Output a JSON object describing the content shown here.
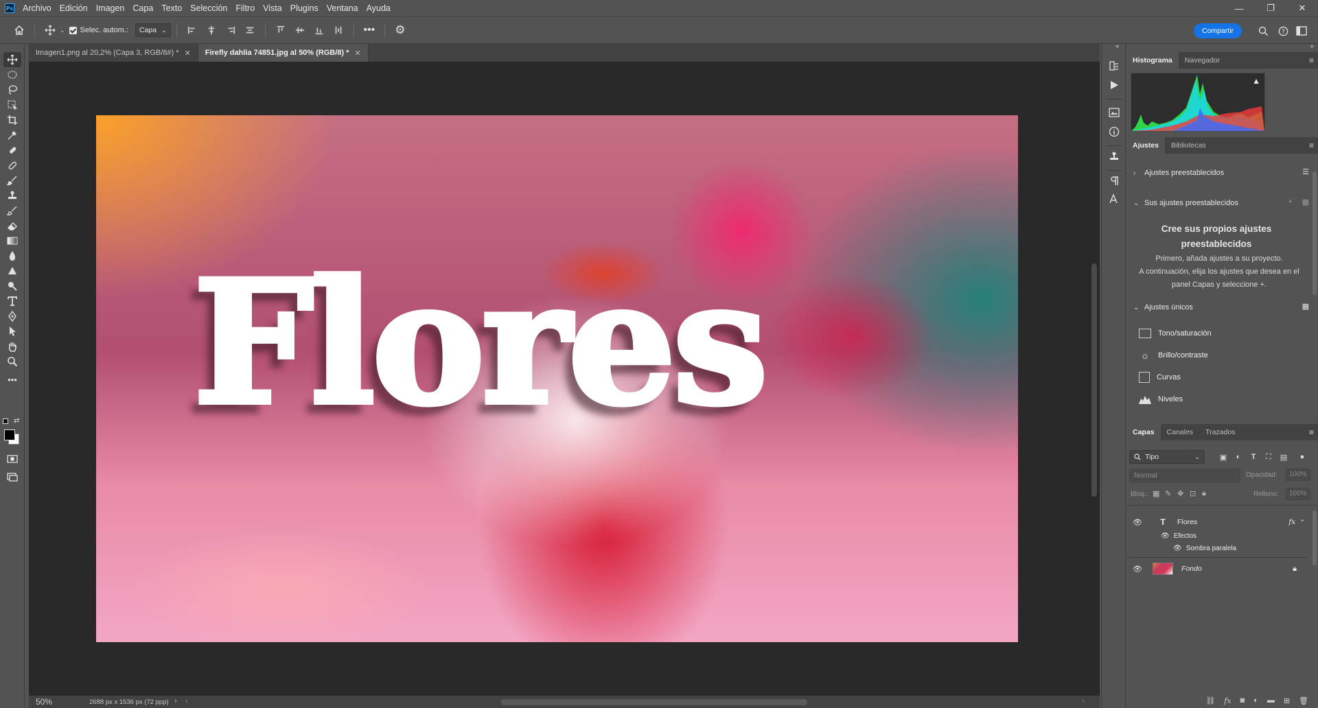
{
  "menubar": {
    "app_icon": "Ps",
    "items": [
      "Archivo",
      "Edición",
      "Imagen",
      "Capa",
      "Texto",
      "Selección",
      "Filtro",
      "Vista",
      "Plugins",
      "Ventana",
      "Ayuda"
    ]
  },
  "window_controls": {
    "minimize": "—",
    "restore": "❐",
    "close": "✕"
  },
  "options": {
    "autoselect_label": "Selec. autom.:",
    "layer_select_value": "Capa",
    "share_button": "Compartir"
  },
  "tabs": [
    {
      "label": "Imagen1.png al 20,2% (Capa 3, RGB/8#) *",
      "active": false
    },
    {
      "label": "Firefly dahlia 74851.jpg al 50% (RGB/8) *",
      "active": true
    }
  ],
  "canvas": {
    "overlay_text": "Flores"
  },
  "status": {
    "zoom": "50%",
    "doc_info": "2688 px x 1536 px (72 ppp)"
  },
  "histogram_panel": {
    "tabs": [
      "Histograma",
      "Navegador"
    ],
    "warning_icon": "warning-icon"
  },
  "adjustments_panel": {
    "tabs": [
      "Ajustes",
      "Bibliotecas"
    ],
    "preset_section": "Ajustes preestablecidos",
    "your_presets_section": "Sus ajustes preestablecidos",
    "empty_title": "Cree sus propios ajustes preestablecidos",
    "empty_desc_1": "Primero, añada ajustes a su proyecto.",
    "empty_desc_2": "A continuación, elija los ajustes que desea en el panel Capas y seleccione +.",
    "single_section": "Ajustes únicos",
    "items": [
      "Tono/saturación",
      "Brillo/contraste",
      "Curvas",
      "Niveles"
    ]
  },
  "layers_panel": {
    "tabs": [
      "Capas",
      "Canales",
      "Trazados"
    ],
    "filter_value": "Tipo",
    "blend_mode": "Normal",
    "opacity_label": "Opacidad:",
    "opacity_value": "100%",
    "lock_label": "Bloq.:",
    "fill_label": "Relleno:",
    "fill_value": "100%",
    "layers": [
      {
        "name": "Flores",
        "type": "text",
        "fx": "fx"
      },
      {
        "name": "Efectos"
      },
      {
        "name": "Sombra paralela"
      },
      {
        "name": "Fondo",
        "type": "image"
      }
    ]
  },
  "colors": {
    "accent": "#1473e6",
    "panel_bg": "#535353",
    "canvas_bg": "#282828"
  }
}
